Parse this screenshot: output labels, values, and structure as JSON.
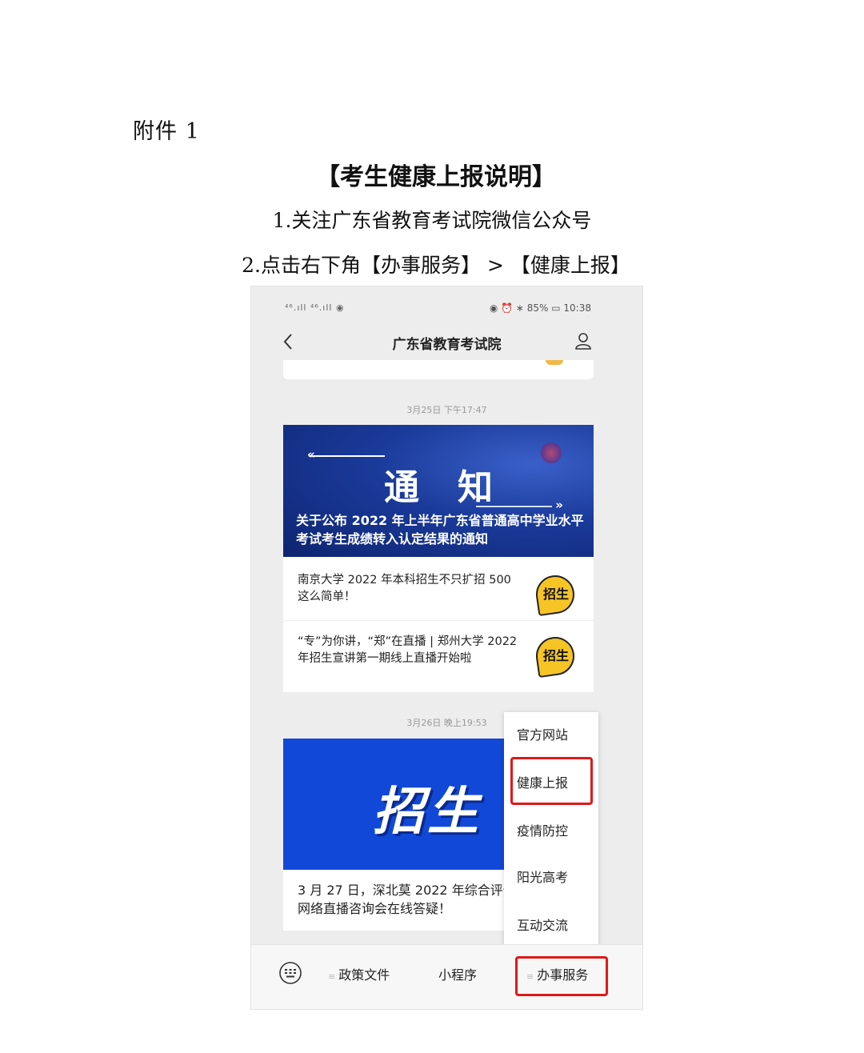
{
  "document": {
    "label": "附件 1",
    "title": "【考生健康上报说明】",
    "step1": "1.关注广东省教育考试院微信公众号",
    "step2": "2.点击右下角【办事服务】 > 【健康上报】"
  },
  "phone": {
    "status_left": "⁴⁶.ıll ⁴⁶.ıll ◉",
    "status_right": "◉ ⏰ ∗ 85% ▭ 10:38",
    "nav_title": "广东省教育考试院",
    "feed": {
      "timestamp_1": "3月25日 下午17:47",
      "banner_1_big": "通知",
      "banner_1_caption": "关于公布 2022 年上半年广东省普通高中学业水平考试考生成绩转入认定结果的通知",
      "news": [
        {
          "text": "南京大学 2022 年本科招生不只扩招 500 这么简单！",
          "thumb": "招生"
        },
        {
          "text": "“专”为你讲，“郑”在直播 | 郑州大学 2022 年招生宣讲第一期线上直播开始啦",
          "thumb": "招生"
        }
      ],
      "timestamp_2": "3月26日 晚上19:53",
      "banner_2_big": "招生",
      "card_2_text": "3 月 27 日，深北莫 2022 年综合评价网络直播咨询会在线答疑！"
    },
    "menu": {
      "items": [
        "官方网站",
        "健康上报",
        "疫情防控",
        "阳光高考",
        "互动交流"
      ],
      "highlighted_index": 1
    },
    "bottom_bar": {
      "tabs": [
        "政策文件",
        "小程序",
        "办事服务"
      ],
      "highlighted_tab": "办事服务"
    },
    "colors": {
      "highlight": "#e01818",
      "banner_blue": "#1248d8",
      "badge_yellow": "#f6c425"
    }
  }
}
